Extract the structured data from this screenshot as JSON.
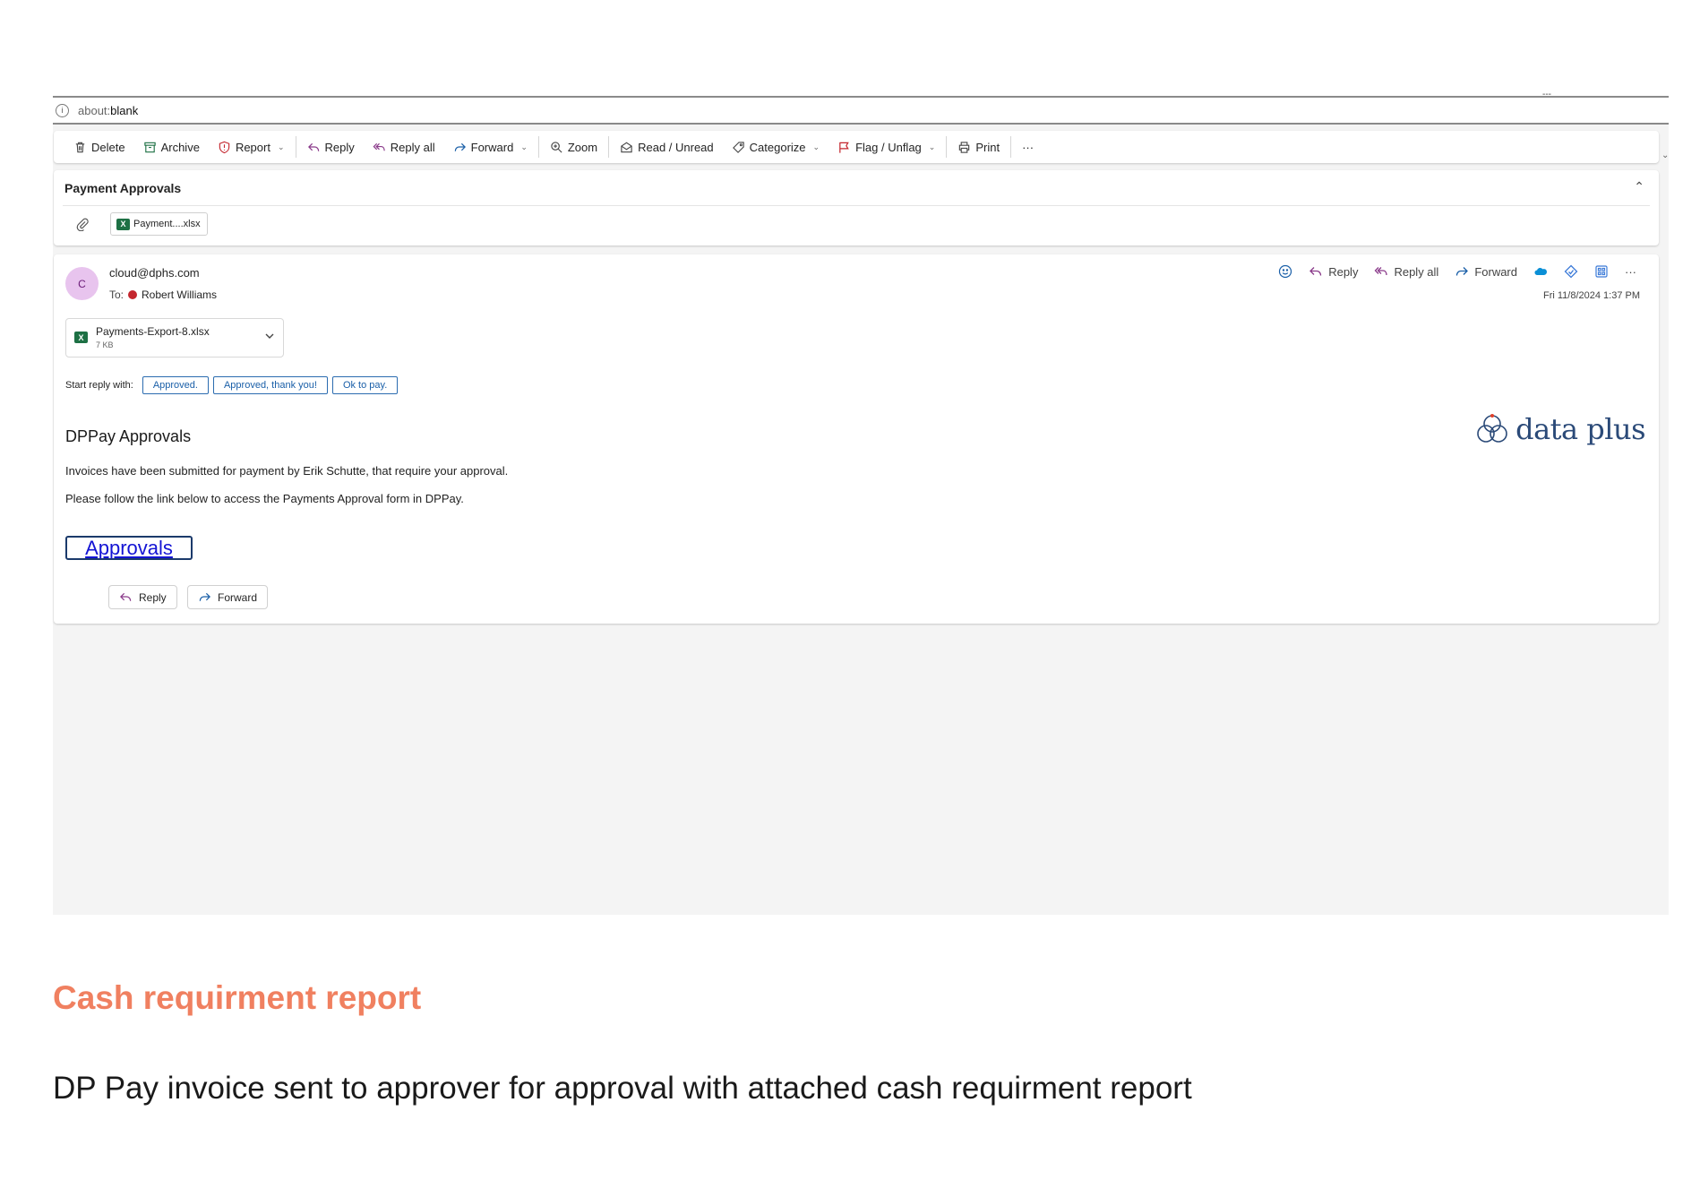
{
  "browser": {
    "url_prefix": "about:",
    "url_suffix": "blank",
    "corner_mark": "---"
  },
  "toolbar": {
    "items": [
      "Delete",
      "Archive",
      "Report",
      "Reply",
      "Reply all",
      "Forward",
      "Zoom",
      "Read / Unread",
      "Categorize",
      "Flag / Unflag",
      "Print"
    ],
    "more": "···"
  },
  "subject": {
    "title": "Payment Approvals",
    "attachment_chip": "Payment....xlsx"
  },
  "message": {
    "avatar_initial": "C",
    "from": "cloud@dphs.com",
    "to_label": "To:",
    "to_name": "Robert Williams",
    "actions": {
      "reply": "Reply",
      "reply_all": "Reply all",
      "forward": "Forward",
      "more": "···"
    },
    "date": "Fri 11/8/2024 1:37 PM",
    "attachment": {
      "name": "Payments-Export-8.xlsx",
      "size": "7 KB",
      "icon_letter": "X"
    },
    "quick_reply": {
      "label": "Start reply with:",
      "options": [
        "Approved.",
        "Approved, thank you!",
        "Ok to pay."
      ]
    },
    "logo_text": "data plus",
    "body_title": "DPPay Approvals",
    "paragraph_1": "Invoices have been submitted for payment by Erik Schutte, that require your approval.",
    "paragraph_2": "Please follow the link below to access the Payments Approval form in DPPay.",
    "approvals_link": "Approvals",
    "footer": {
      "reply": "Reply",
      "forward": "Forward"
    }
  },
  "caption": {
    "title": "Cash requirment report",
    "text": "DP Pay invoice sent to approver for approval with attached cash requirment report"
  },
  "colors": {
    "caption_accent": "#f08060",
    "link": "#1414d4",
    "excel_green": "#1d7044",
    "presence_busy": "#c4262e",
    "avatar_bg": "#e8c4ee"
  }
}
